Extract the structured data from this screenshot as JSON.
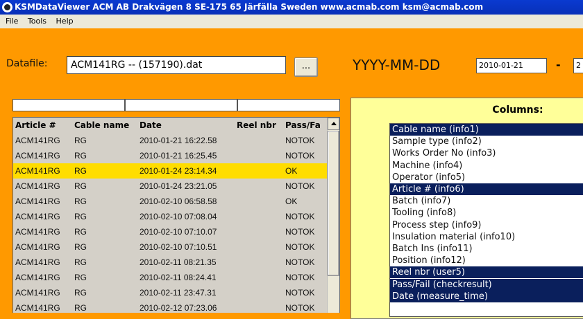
{
  "window": {
    "title": "KSMDataViewer  ACM AB  Drakvägen 8  SE-175 65 Järfälla  Sweden  www.acmab.com  ksm@acmab.com"
  },
  "menu": [
    "File",
    "Tools",
    "Help"
  ],
  "datafile": {
    "label": "Datafile:",
    "value": "ACM141RG -- (157190).dat",
    "browse_label": "..."
  },
  "dates": {
    "format_label": "YYYY-MM-DD",
    "from": "2010-01-21",
    "separator": "-",
    "to": "2"
  },
  "grid": {
    "headers": [
      "Article #",
      "Cable name",
      "Date",
      "Reel nbr",
      "Pass/Fa"
    ],
    "rows": [
      [
        "ACM141RG",
        "RG",
        "2010-01-21 16:22.58",
        "",
        "NOTOK"
      ],
      [
        "ACM141RG",
        "RG",
        "2010-01-21 16:25.45",
        "",
        "NOTOK"
      ],
      [
        "ACM141RG",
        "RG",
        "2010-01-24 23:14.34",
        "",
        "OK"
      ],
      [
        "ACM141RG",
        "RG",
        "2010-01-24 23:21.05",
        "",
        "NOTOK"
      ],
      [
        "ACM141RG",
        "RG",
        "2010-02-10 06:58.58",
        "",
        "OK"
      ],
      [
        "ACM141RG",
        "RG",
        "2010-02-10 07:08.04",
        "",
        "NOTOK"
      ],
      [
        "ACM141RG",
        "RG",
        "2010-02-10 07:10.07",
        "",
        "NOTOK"
      ],
      [
        "ACM141RG",
        "RG",
        "2010-02-10 07:10.51",
        "",
        "NOTOK"
      ],
      [
        "ACM141RG",
        "RG",
        "2010-02-11 08:21.35",
        "",
        "NOTOK"
      ],
      [
        "ACM141RG",
        "RG",
        "2010-02-11 08:24.41",
        "",
        "NOTOK"
      ],
      [
        "ACM141RG",
        "RG",
        "2010-02-11 23:47.31",
        "",
        "NOTOK"
      ],
      [
        "ACM141RG",
        "RG",
        "2010-02-12 07:23.06",
        "",
        "NOTOK"
      ]
    ],
    "selected_row": 2
  },
  "columns_panel": {
    "title": "Columns:",
    "items": [
      {
        "label": "Cable name (info1)",
        "selected": true
      },
      {
        "label": "Sample type (info2)",
        "selected": false
      },
      {
        "label": "Works Order No (info3)",
        "selected": false
      },
      {
        "label": "Machine (info4)",
        "selected": false
      },
      {
        "label": "Operator (info5)",
        "selected": false
      },
      {
        "label": "Article # (info6)",
        "selected": true
      },
      {
        "label": "Batch (info7)",
        "selected": false
      },
      {
        "label": "Tooling (info8)",
        "selected": false
      },
      {
        "label": "Process step (info9)",
        "selected": false
      },
      {
        "label": "Insulation material (info10)",
        "selected": false
      },
      {
        "label": "Batch Ins (info11)",
        "selected": false
      },
      {
        "label": "Position (info12)",
        "selected": false
      },
      {
        "label": "Reel nbr (user5)",
        "selected": true
      },
      {
        "label": "Pass/Fail (checkresult)",
        "selected": true
      },
      {
        "label": "Date (measure_time)",
        "selected": true
      }
    ]
  },
  "colors": {
    "background": "#ff9900",
    "titlebar": "#0a3ad0",
    "selected_row": "#ffdd00",
    "columns_panel": "#ffff99",
    "list_selection": "#0a1f5c"
  }
}
